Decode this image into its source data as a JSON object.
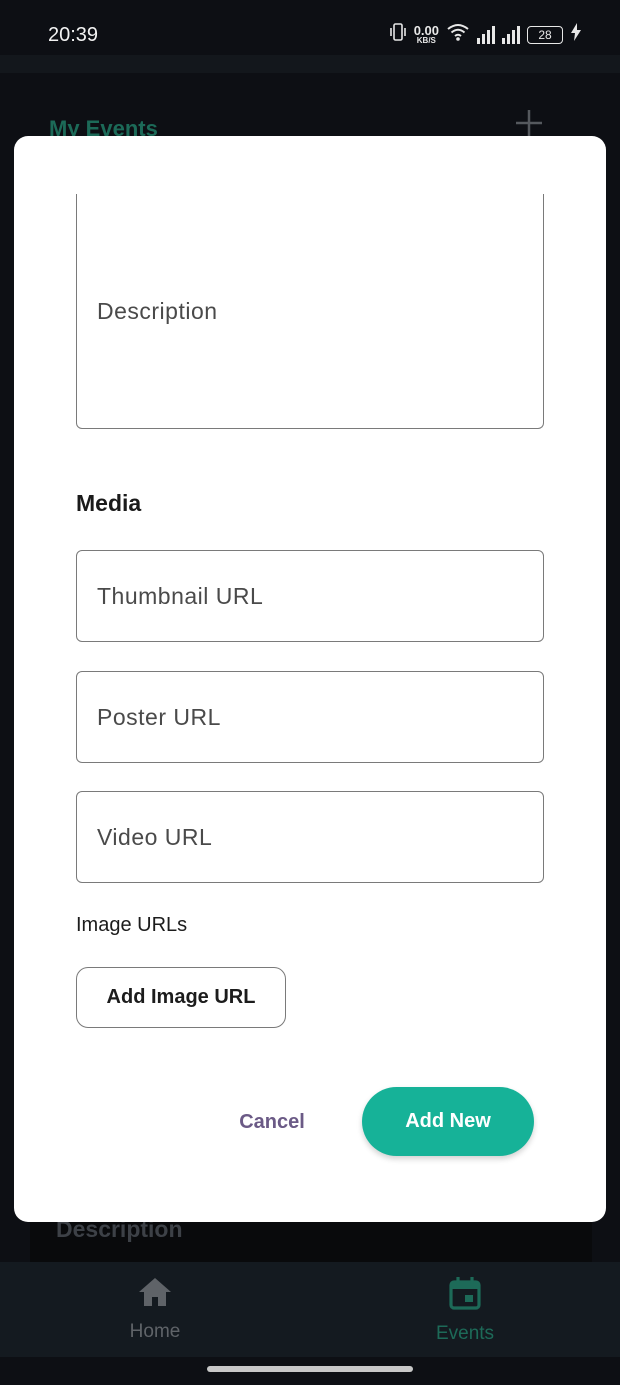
{
  "status_bar": {
    "time": "20:39",
    "net_speed_value": "0.00",
    "net_speed_unit": "KB/S",
    "battery": "28",
    "icons": [
      "vibrate-icon",
      "wifi-icon",
      "signal-icon",
      "signal-icon",
      "battery-icon",
      "charging-icon"
    ]
  },
  "app": {
    "title": "My Events",
    "add_icon": "plus-icon",
    "behind_card_label": "Description"
  },
  "dialog": {
    "description_placeholder": "Description",
    "media_heading": "Media",
    "thumbnail_placeholder": "Thumbnail URL",
    "poster_placeholder": "Poster URL",
    "video_placeholder": "Video URL",
    "image_urls_label": "Image URLs",
    "add_image_button": "Add Image URL",
    "cancel_button": "Cancel",
    "add_new_button": "Add New"
  },
  "bottom_nav": {
    "items": [
      {
        "label": "Home",
        "icon": "home-icon",
        "active": false
      },
      {
        "label": "Events",
        "icon": "calendar-icon",
        "active": true
      }
    ]
  },
  "colors": {
    "accent": "#16b298",
    "cancel_text": "#6b5a86",
    "active_nav": "#1d6a58",
    "background": "#0d0f14"
  }
}
